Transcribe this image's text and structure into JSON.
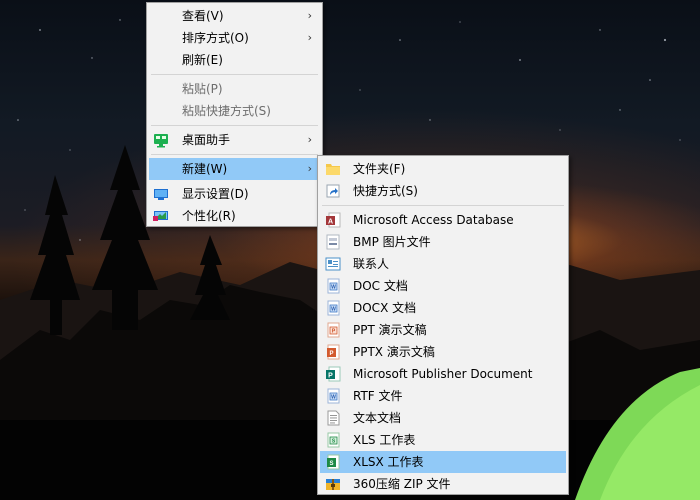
{
  "context_menu": {
    "items": [
      {
        "label": "查看(V)",
        "has_submenu": true
      },
      {
        "label": "排序方式(O)",
        "has_submenu": true
      },
      {
        "label": "刷新(E)"
      },
      {
        "label": "粘贴(P)",
        "disabled": true
      },
      {
        "label": "粘贴快捷方式(S)",
        "disabled": true
      },
      {
        "label": "桌面助手",
        "icon": "desktop-assistant-icon",
        "has_submenu": true
      },
      {
        "label": "新建(W)",
        "has_submenu": true,
        "highlighted": true
      },
      {
        "label": "显示设置(D)",
        "icon": "display-settings-icon"
      },
      {
        "label": "个性化(R)",
        "icon": "personalize-icon"
      }
    ]
  },
  "new_submenu": {
    "items": [
      {
        "label": "文件夹(F)",
        "icon": "folder-icon"
      },
      {
        "label": "快捷方式(S)",
        "icon": "shortcut-icon"
      },
      {
        "label": "Microsoft Access Database",
        "icon": "access-icon"
      },
      {
        "label": "BMP 图片文件",
        "icon": "bmp-icon"
      },
      {
        "label": "联系人",
        "icon": "contact-icon"
      },
      {
        "label": "DOC 文档",
        "icon": "doc-icon"
      },
      {
        "label": "DOCX 文档",
        "icon": "docx-icon"
      },
      {
        "label": "PPT 演示文稿",
        "icon": "ppt-icon"
      },
      {
        "label": "PPTX 演示文稿",
        "icon": "pptx-icon"
      },
      {
        "label": "Microsoft Publisher Document",
        "icon": "publisher-icon"
      },
      {
        "label": "RTF 文件",
        "icon": "rtf-icon"
      },
      {
        "label": "文本文档",
        "icon": "text-document-icon"
      },
      {
        "label": "XLS 工作表",
        "icon": "xls-icon"
      },
      {
        "label": "XLSX 工作表",
        "icon": "xlsx-icon",
        "highlighted": true
      },
      {
        "label": "360压缩 ZIP 文件",
        "icon": "zip-archive-icon"
      }
    ]
  },
  "colors": {
    "menu_bg": "#f2f2f2",
    "highlight": "#91c9f7",
    "disabled_text": "#6d6d6d",
    "tent_green": "#7ed957"
  }
}
